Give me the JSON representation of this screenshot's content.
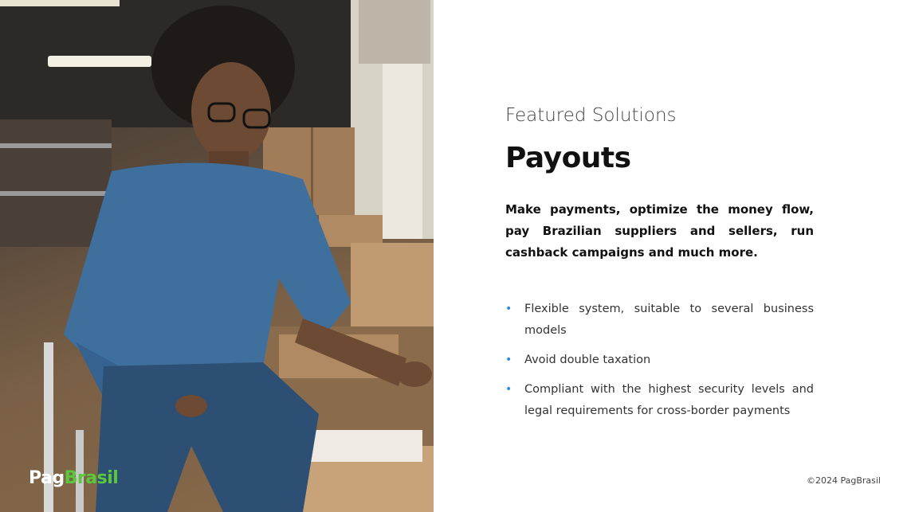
{
  "brand": {
    "part1": "Pag",
    "part2": "Brasil",
    "accent_color": "#5ac83c"
  },
  "kicker": "Featured Solutions",
  "title": "Payouts",
  "lead": "Make payments, optimize the money flow, pay Brazilian suppliers and sellers, run cashback campaigns and much more.",
  "bullets": [
    "Flexible system, suitable to several business models",
    "Avoid double taxation",
    "Compliant with the highest security levels and legal requirements for cross-border payments"
  ],
  "bullet_glyph": "•",
  "footer": "©2024 PagBrasil",
  "colors": {
    "bullet": "#2a8fd8",
    "title": "#111111"
  }
}
